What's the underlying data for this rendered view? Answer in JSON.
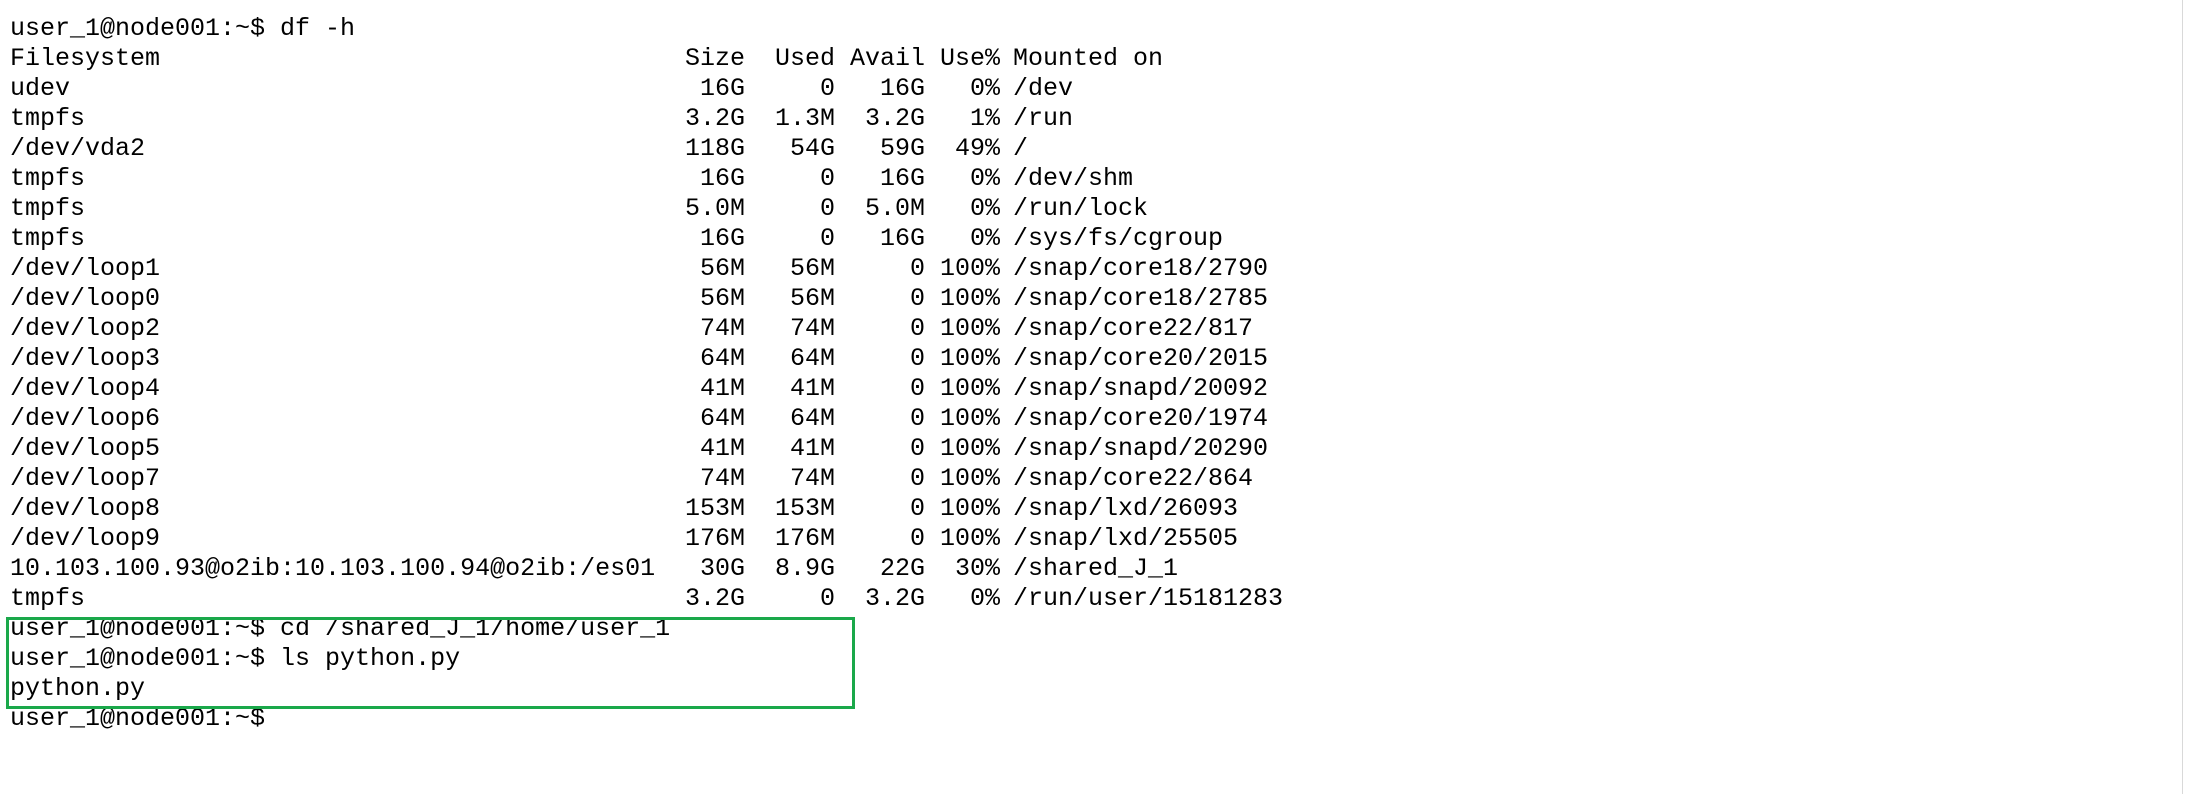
{
  "terminal": {
    "prompt": "user_1@node001:~$",
    "highlight_color": "#1aa84a",
    "command_df": "user_1@node001:~$ df -h",
    "df_header": {
      "filesystem": "Filesystem",
      "size": "Size",
      "used": "Used",
      "avail": "Avail",
      "use_pct": "Use%",
      "mounted_on": "Mounted on"
    },
    "df_rows": [
      {
        "filesystem": "udev",
        "size": "16G",
        "used": "0",
        "avail": "16G",
        "use_pct": "0%",
        "mounted_on": "/dev"
      },
      {
        "filesystem": "tmpfs",
        "size": "3.2G",
        "used": "1.3M",
        "avail": "3.2G",
        "use_pct": "1%",
        "mounted_on": "/run"
      },
      {
        "filesystem": "/dev/vda2",
        "size": "118G",
        "used": "54G",
        "avail": "59G",
        "use_pct": "49%",
        "mounted_on": "/"
      },
      {
        "filesystem": "tmpfs",
        "size": "16G",
        "used": "0",
        "avail": "16G",
        "use_pct": "0%",
        "mounted_on": "/dev/shm"
      },
      {
        "filesystem": "tmpfs",
        "size": "5.0M",
        "used": "0",
        "avail": "5.0M",
        "use_pct": "0%",
        "mounted_on": "/run/lock"
      },
      {
        "filesystem": "tmpfs",
        "size": "16G",
        "used": "0",
        "avail": "16G",
        "use_pct": "0%",
        "mounted_on": "/sys/fs/cgroup"
      },
      {
        "filesystem": "/dev/loop1",
        "size": "56M",
        "used": "56M",
        "avail": "0",
        "use_pct": "100%",
        "mounted_on": "/snap/core18/2790"
      },
      {
        "filesystem": "/dev/loop0",
        "size": "56M",
        "used": "56M",
        "avail": "0",
        "use_pct": "100%",
        "mounted_on": "/snap/core18/2785"
      },
      {
        "filesystem": "/dev/loop2",
        "size": "74M",
        "used": "74M",
        "avail": "0",
        "use_pct": "100%",
        "mounted_on": "/snap/core22/817"
      },
      {
        "filesystem": "/dev/loop3",
        "size": "64M",
        "used": "64M",
        "avail": "0",
        "use_pct": "100%",
        "mounted_on": "/snap/core20/2015"
      },
      {
        "filesystem": "/dev/loop4",
        "size": "41M",
        "used": "41M",
        "avail": "0",
        "use_pct": "100%",
        "mounted_on": "/snap/snapd/20092"
      },
      {
        "filesystem": "/dev/loop6",
        "size": "64M",
        "used": "64M",
        "avail": "0",
        "use_pct": "100%",
        "mounted_on": "/snap/core20/1974"
      },
      {
        "filesystem": "/dev/loop5",
        "size": "41M",
        "used": "41M",
        "avail": "0",
        "use_pct": "100%",
        "mounted_on": "/snap/snapd/20290"
      },
      {
        "filesystem": "/dev/loop7",
        "size": "74M",
        "used": "74M",
        "avail": "0",
        "use_pct": "100%",
        "mounted_on": "/snap/core22/864"
      },
      {
        "filesystem": "/dev/loop8",
        "size": "153M",
        "used": "153M",
        "avail": "0",
        "use_pct": "100%",
        "mounted_on": "/snap/lxd/26093"
      },
      {
        "filesystem": "/dev/loop9",
        "size": "176M",
        "used": "176M",
        "avail": "0",
        "use_pct": "100%",
        "mounted_on": "/snap/lxd/25505"
      },
      {
        "filesystem": "10.103.100.93@o2ib:10.103.100.94@o2ib:/es01",
        "size": "30G",
        "used": "8.9G",
        "avail": "22G",
        "use_pct": "30%",
        "mounted_on": "/shared_J_1"
      },
      {
        "filesystem": "tmpfs",
        "size": "3.2G",
        "used": "0",
        "avail": "3.2G",
        "use_pct": "0%",
        "mounted_on": "/run/user/15181283"
      }
    ],
    "command_cd": "user_1@node001:~$ cd /shared_J_1/home/user_1",
    "command_ls": "user_1@node001:~$ ls python.py",
    "ls_output": "python.py",
    "final_prompt": "user_1@node001:~$"
  }
}
